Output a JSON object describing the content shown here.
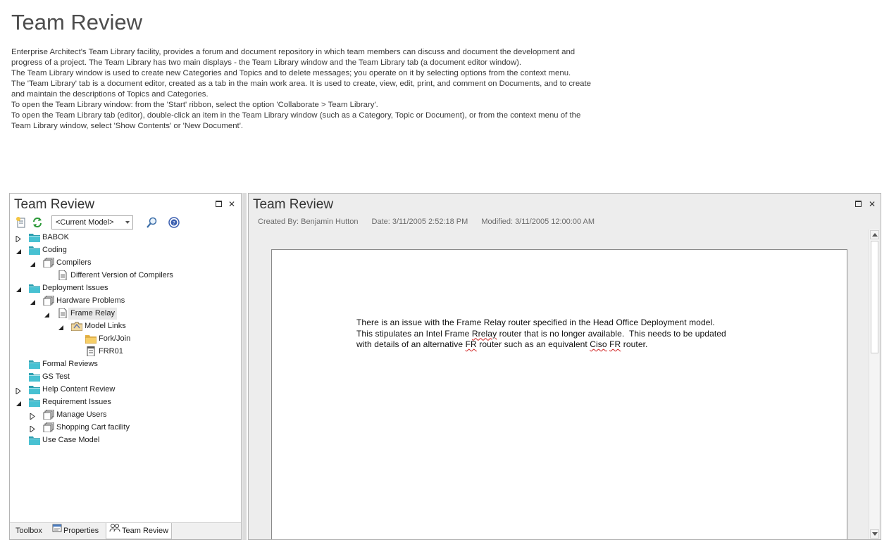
{
  "page": {
    "title": "Team Review",
    "description_lines": [
      "Enterprise Architect's Team Library facility, provides a forum and document repository in which team members can discuss and document the development and",
      "progress of a project. The Team Library has two main displays - the Team Library window and the Team Library tab (a document editor window).",
      "The Team Library window is used to create new Categories and Topics and to delete messages; you operate on it by selecting options from the context menu.",
      "The 'Team Library' tab is a document editor, created as a tab in the main work area.  It is used to create, view, edit, print, and comment on Documents, and to create",
      "and maintain the descriptions of Topics and Categories.",
      "To open the Team Library window:  from the 'Start' ribbon, select the option 'Collaborate > Team Library'.",
      "To open the Team Library tab (editor), double-click an item in the Team Library window (such as a Category, Topic or Document), or from the context menu of the",
      "Team Library window, select 'Show Contents' or 'New Document'."
    ]
  },
  "left_panel": {
    "title": "Team Review",
    "model_select": "<Current Model>",
    "tree": [
      {
        "label": "BABOK",
        "icon": "category-folder-icon",
        "expander": "collapsed",
        "depth": 0
      },
      {
        "label": "Coding",
        "icon": "category-folder-icon",
        "expander": "expanded",
        "depth": 0
      },
      {
        "label": "Compilers",
        "icon": "topic-icon",
        "expander": "expanded",
        "depth": 1
      },
      {
        "label": "Different Version of Compilers",
        "icon": "document-icon",
        "expander": "none",
        "depth": 2
      },
      {
        "label": "Deployment Issues",
        "icon": "category-folder-icon",
        "expander": "expanded",
        "depth": 0
      },
      {
        "label": "Hardware Problems",
        "icon": "topic-icon",
        "expander": "expanded",
        "depth": 1
      },
      {
        "label": "Frame Relay",
        "icon": "document-icon",
        "expander": "expanded",
        "depth": 2,
        "selected": true
      },
      {
        "label": "Model Links",
        "icon": "model-links-icon",
        "expander": "expanded",
        "depth": 3
      },
      {
        "label": "Fork/Join",
        "icon": "package-folder-icon",
        "expander": "none",
        "depth": 4
      },
      {
        "label": "FRR01",
        "icon": "element-icon",
        "expander": "none",
        "depth": 4
      },
      {
        "label": "Formal Reviews",
        "icon": "category-folder-icon",
        "expander": "none",
        "depth": 0
      },
      {
        "label": "GS Test",
        "icon": "category-folder-icon",
        "expander": "none",
        "depth": 0
      },
      {
        "label": "Help Content Review",
        "icon": "category-folder-icon",
        "expander": "collapsed",
        "depth": 0
      },
      {
        "label": "Requirement Issues",
        "icon": "category-folder-icon",
        "expander": "expanded",
        "depth": 0
      },
      {
        "label": "Manage Users",
        "icon": "topic-icon",
        "expander": "collapsed",
        "depth": 1
      },
      {
        "label": "Shopping Cart facility",
        "icon": "topic-icon",
        "expander": "collapsed",
        "depth": 1
      },
      {
        "label": "Use Case Model",
        "icon": "category-folder-icon",
        "expander": "none",
        "depth": 0
      }
    ],
    "bottom_tabs": [
      {
        "label": "Toolbox",
        "icon": "",
        "active": false
      },
      {
        "label": "Properties",
        "icon": "properties-icon",
        "active": false
      },
      {
        "label": "Team Review",
        "icon": "team-review-icon",
        "active": true
      }
    ]
  },
  "right_panel": {
    "title": "Team Review",
    "created_by": "Created By: Benjamin Hutton",
    "date": "Date: 3/11/2005 2:52:18 PM",
    "modified": "Modified: 3/11/2005 12:00:00 AM",
    "document_lines": [
      "There is an issue with the Frame Relay router specified in the Head Office Deployment model.",
      "This stipulates an Intel Frame Rrelay router that is no longer available.  This needs to be updated",
      "with details of an alternative FR router such as an equivalent Ciso FR router."
    ]
  }
}
